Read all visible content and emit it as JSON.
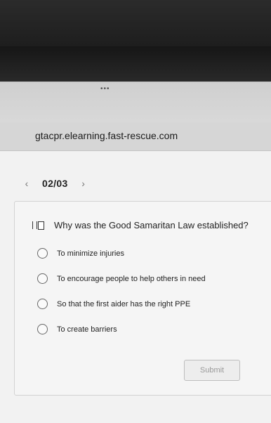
{
  "browser": {
    "tab_indicator": "•••",
    "url": "gtacpr.elearning.fast-rescue.com"
  },
  "pager": {
    "prev_icon": "chevron-left-icon",
    "label": "02/03",
    "next_icon": "chevron-right-icon"
  },
  "question": {
    "flag_icon": "bookmark-flag-icon",
    "text": "Why was the Good Samaritan Law established?",
    "options": [
      {
        "label": "To minimize injuries"
      },
      {
        "label": "To encourage people to help others in need"
      },
      {
        "label": "So that the first aider has the right PPE"
      },
      {
        "label": "To create barriers"
      }
    ]
  },
  "submit": {
    "label": "Submit"
  },
  "colors": {
    "page_background": "#f2f2f2",
    "submit_text": "#9a9a9a"
  }
}
